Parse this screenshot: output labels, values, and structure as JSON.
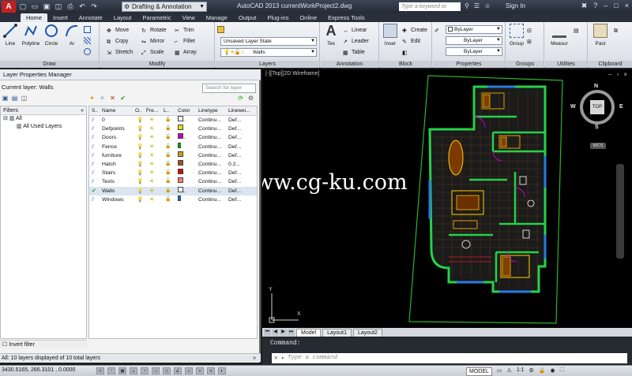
{
  "titlebar": {
    "logo": "A",
    "workspace": "Drafting & Annotation",
    "title": "AutoCAD 2013    currentWorkProject2.dwg",
    "search_placeholder": "Type a keyword or phrase",
    "signin": "Sign In"
  },
  "ribbon": {
    "tabs": [
      "Home",
      "Insert",
      "Annotate",
      "Layout",
      "Parametric",
      "View",
      "Manage",
      "Output",
      "Plug-ins",
      "Online",
      "Express Tools"
    ],
    "panels": {
      "draw": {
        "label": "Draw",
        "line": "Line",
        "polyline": "Polyline",
        "circle": "Circle",
        "arc": "Ar"
      },
      "modify": {
        "label": "Modify",
        "move": "Move",
        "rotate": "Rotate",
        "trim": "Trim",
        "copy": "Copy",
        "mirror": "Mirror",
        "fillet": "Fillet",
        "stretch": "Stretch",
        "scale": "Scale",
        "array": "Array"
      },
      "layers": {
        "label": "Layers",
        "state": "Unsaved Layer State",
        "current": "Walls"
      },
      "annotation": {
        "label": "Annotation",
        "text": "Tex",
        "linear": "Linear",
        "leader": "Leader",
        "table": "Table"
      },
      "block": {
        "label": "Block",
        "insert": "Inser",
        "create": "Create",
        "edit": "Edit"
      },
      "properties": {
        "label": "Properties",
        "color": "ByLayer",
        "linetype": "ByLayer",
        "lineweight": "ByLayer"
      },
      "groups": {
        "label": "Groups",
        "group": "Group"
      },
      "utilities": {
        "label": "Utilities",
        "measure": "Measur"
      },
      "clipboard": {
        "label": "Clipboard",
        "paste": "Past"
      }
    }
  },
  "layer_manager": {
    "title": "Layer Properties Manager",
    "current_layer": "Current layer: Walls",
    "search_placeholder": "Search for layer",
    "filters_label": "Filters",
    "tree": [
      "All",
      "All Used Layers"
    ],
    "columns": [
      "S..",
      "Name",
      "O..",
      "Fre...",
      "L..",
      "Color",
      "Linetype",
      "Linewei..."
    ],
    "layers": [
      {
        "name": "0",
        "color_name": "w...",
        "color": "#ffffff",
        "linetype": "Continu...",
        "lineweight": "Def..."
      },
      {
        "name": "Defpoints",
        "color_name": "51",
        "color": "#e8e000",
        "linetype": "Continu...",
        "lineweight": "Def..."
      },
      {
        "name": "Doors",
        "color_name": "2...",
        "color": "#c000c0",
        "linetype": "Continu...",
        "lineweight": "Def..."
      },
      {
        "name": "Fence",
        "color_name": "3",
        "color": "#00a000",
        "linetype": "Continu...",
        "lineweight": "Def..."
      },
      {
        "name": "furniture",
        "color_name": "41",
        "color": "#d4a000",
        "linetype": "Continu...",
        "lineweight": "Def..."
      },
      {
        "name": "Hatch",
        "color_name": "27",
        "color": "#a05020",
        "linetype": "Continu...",
        "lineweight": "0.2..."
      },
      {
        "name": "Stairs",
        "color_name": "10",
        "color": "#e00000",
        "linetype": "Continu...",
        "lineweight": "Def..."
      },
      {
        "name": "Texts",
        "color_name": "11",
        "color": "#ff8060",
        "linetype": "Continu...",
        "lineweight": "Def..."
      },
      {
        "name": "Walls",
        "color_name": "w...",
        "color": "#ffffff",
        "linetype": "Continu...",
        "lineweight": "Def..."
      },
      {
        "name": "Windows",
        "color_name": "5",
        "color": "#1060d0",
        "linetype": "Continu...",
        "lineweight": "Def..."
      }
    ],
    "invert_filter": "Invert filter",
    "status": "All: 10 layers displayed of 10 total layers"
  },
  "viewport": {
    "label": "[-][Top][2D Wireframe]",
    "viewcube": {
      "top": "TOP",
      "n": "N",
      "s": "S",
      "w": "W",
      "e": "E",
      "wcs": "WCS"
    },
    "ucs_x": "X",
    "ucs_y": "Y",
    "watermark": "www.cg-ku.com"
  },
  "layout_tabs": [
    "Model",
    "Layout1",
    "Layout2"
  ],
  "command": {
    "history": "Command:",
    "placeholder": "Type a command"
  },
  "statusbar": {
    "coords": "3430.5165, 266.3101 , 0.0000",
    "model": "MODEL",
    "scale": "1:1"
  }
}
